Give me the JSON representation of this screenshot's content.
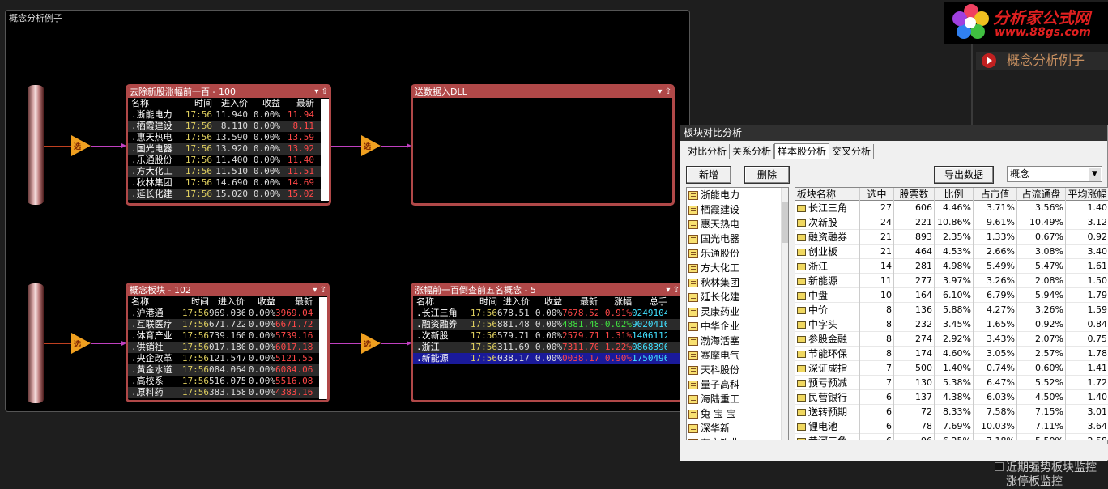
{
  "canvas": {
    "title": "概念分析例子"
  },
  "triangle_label": "选",
  "panel1": {
    "title": "去除新股涨幅前一百 - 100",
    "headers": {
      "name": "名称",
      "time": "时间",
      "price": "进入价",
      "gain": "收益",
      "last": "最新"
    },
    "rows": [
      {
        "name": ".浙能电力",
        "time": "17:56",
        "price": "11.940",
        "gain": "0.00%",
        "last": "11.94"
      },
      {
        "name": ".栖霞建设",
        "time": "17:56",
        "price": "8.110",
        "gain": "0.00%",
        "last": "8.11"
      },
      {
        "name": ".惠天热电",
        "time": "17:56",
        "price": "13.590",
        "gain": "0.00%",
        "last": "13.59"
      },
      {
        "name": ".国光电器",
        "time": "17:56",
        "price": "13.920",
        "gain": "0.00%",
        "last": "13.92"
      },
      {
        "name": ".乐通股份",
        "time": "17:56",
        "price": "11.400",
        "gain": "0.00%",
        "last": "11.40"
      },
      {
        "name": ".方大化工",
        "time": "17:56",
        "price": "11.510",
        "gain": "0.00%",
        "last": "11.51"
      },
      {
        "name": ".秋林集团",
        "time": "17:56",
        "price": "14.690",
        "gain": "0.00%",
        "last": "14.69"
      },
      {
        "name": ".延长化建",
        "time": "17:56",
        "price": "15.020",
        "gain": "0.00%",
        "last": "15.02"
      }
    ]
  },
  "panel2": {
    "title": "送数据入DLL"
  },
  "panel3": {
    "title": "概念板块 - 102",
    "headers": {
      "name": "名称",
      "time": "时间",
      "price": "进入价",
      "gain": "收益",
      "last": "最新"
    },
    "rows": [
      {
        "name": ".沪港通",
        "time": "17:56",
        "price": "969.036",
        "gain": "0.00%",
        "last": "3969.04"
      },
      {
        "name": ".互联医疗",
        "time": "17:56",
        "price": "671.722",
        "gain": "0.00%",
        "last": "6671.72"
      },
      {
        "name": ".体育产业",
        "time": "17:56",
        "price": "739.160",
        "gain": "0.00%",
        "last": "5739.16"
      },
      {
        "name": ".供销社",
        "time": "17:56",
        "price": "017.180",
        "gain": "0.00%",
        "last": "6017.18"
      },
      {
        "name": ".央企改革",
        "time": "17:56",
        "price": "121.547",
        "gain": "0.00%",
        "last": "5121.55"
      },
      {
        "name": ".黄金水道",
        "time": "17:56",
        "price": "084.064",
        "gain": "0.00%",
        "last": "6084.06"
      },
      {
        "name": ".高校系",
        "time": "17:56",
        "price": "516.075",
        "gain": "0.00%",
        "last": "5516.08"
      },
      {
        "name": ".原料药",
        "time": "17:56",
        "price": "383.158",
        "gain": "0.00%",
        "last": "4383.16"
      }
    ]
  },
  "panel4": {
    "title": "涨幅前一百倒查前五名概念 - 5",
    "headers": {
      "name": "名称",
      "time": "时间",
      "price": "进入价",
      "gain": "收益",
      "last": "最新",
      "pct": "涨幅",
      "vol": "总手"
    },
    "rows": [
      {
        "name": ".长江三角",
        "time": "17:56",
        "price": "678.515",
        "gain": "0.00%",
        "last": "7678.52",
        "pct": "0.91%",
        "vol": "0249104195"
      },
      {
        "name": ".融资融券",
        "time": "17:56",
        "price": "881.481",
        "gain": "0.00%",
        "last": "4881.48",
        "pct": "-0.02%",
        "vol": "9020416040"
      },
      {
        "name": ".次新股",
        "time": "17:56",
        "price": "579.711",
        "gain": "0.00%",
        "last": "2579.71",
        "pct": "1.31%",
        "vol": "1406112319"
      },
      {
        "name": ".浙江",
        "time": "17:56",
        "price": "311.698",
        "gain": "0.00%",
        "last": "7311.70",
        "pct": "1.22%",
        "vol": "0868396117"
      },
      {
        "name": ".新能源",
        "time": "17:56",
        "price": "038.175",
        "gain": "0.00%",
        "last": "0038.17",
        "pct": "0.90%",
        "vol": "1750496409"
      }
    ]
  },
  "logo": {
    "line1": "分析家公式网",
    "line2": "www.88gs.com"
  },
  "right_panel": {
    "item": "概念分析例子",
    "bottom1": "近期强势板块监控",
    "bottom2": "涨停板监控"
  },
  "dialog": {
    "title": "板块对比分析",
    "tabs": [
      "对比分析",
      "关系分析",
      "样本股分析",
      "交叉分析"
    ],
    "active_tab": "样本股分析",
    "btn_add": "新增",
    "btn_delete": "删除",
    "btn_export": "导出数据",
    "combo_value": "概念",
    "left_list": [
      "浙能电力",
      "栖霞建设",
      "惠天热电",
      "国光电器",
      "乐通股份",
      "方大化工",
      "秋林集团",
      "延长化建",
      "灵康药业",
      "中华企业",
      "渤海活塞",
      "赛摩电气",
      "天科股份",
      "量子高科",
      "海陆重工",
      "兔 宝 宝",
      "深华新",
      "东方铁业"
    ],
    "grid_headers": [
      "板块名称",
      "选中",
      "股票数",
      "比例",
      "占市值",
      "占流通盘",
      "平均涨幅"
    ],
    "grid_rows": [
      [
        "长江三角",
        "27",
        "606",
        "4.46%",
        "3.71%",
        "3.56%",
        "1.40"
      ],
      [
        "次新股",
        "24",
        "221",
        "10.86%",
        "9.61%",
        "10.49%",
        "3.12"
      ],
      [
        "融资融券",
        "21",
        "893",
        "2.35%",
        "1.33%",
        "0.67%",
        "0.92"
      ],
      [
        "创业板",
        "21",
        "464",
        "4.53%",
        "2.66%",
        "3.08%",
        "3.40"
      ],
      [
        "浙江",
        "14",
        "281",
        "4.98%",
        "5.49%",
        "5.47%",
        "1.61"
      ],
      [
        "新能源",
        "11",
        "277",
        "3.97%",
        "3.26%",
        "2.08%",
        "1.50"
      ],
      [
        "中盘",
        "10",
        "164",
        "6.10%",
        "6.79%",
        "5.94%",
        "1.79"
      ],
      [
        "中价",
        "8",
        "136",
        "5.88%",
        "4.27%",
        "3.26%",
        "1.59"
      ],
      [
        "中字头",
        "8",
        "232",
        "3.45%",
        "1.65%",
        "0.92%",
        "0.84"
      ],
      [
        "参股金融",
        "8",
        "274",
        "2.92%",
        "3.43%",
        "2.07%",
        "0.75"
      ],
      [
        "节能环保",
        "8",
        "174",
        "4.60%",
        "3.05%",
        "2.57%",
        "1.78"
      ],
      [
        "深证成指",
        "7",
        "500",
        "1.40%",
        "0.74%",
        "0.60%",
        "1.41"
      ],
      [
        "预亏预减",
        "7",
        "130",
        "5.38%",
        "6.47%",
        "5.52%",
        "1.72"
      ],
      [
        "民营银行",
        "6",
        "137",
        "4.38%",
        "6.03%",
        "4.50%",
        "1.40"
      ],
      [
        "送转预期",
        "6",
        "72",
        "8.33%",
        "7.58%",
        "7.15%",
        "3.01"
      ],
      [
        "锂电池",
        "6",
        "78",
        "7.69%",
        "10.03%",
        "7.11%",
        "3.64"
      ],
      [
        "黄河三角",
        "6",
        "96",
        "6.25%",
        "7.18%",
        "5.50%",
        "2.58"
      ]
    ]
  }
}
